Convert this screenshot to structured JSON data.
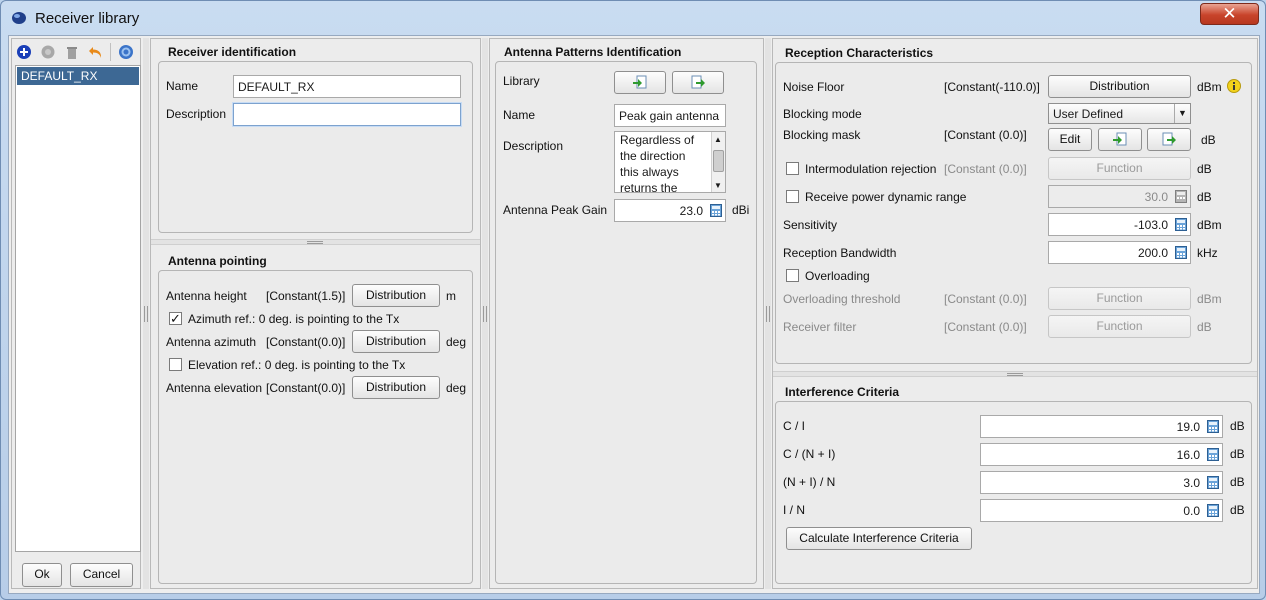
{
  "window": {
    "title": "Receiver library",
    "close_glyph": "✕"
  },
  "colors": {
    "accent": "#3d6894",
    "info": "#f2d21b",
    "close": "#c8442b"
  },
  "left": {
    "toolbar": [
      "add-icon",
      "disabled-circle-icon",
      "trash-icon",
      "undo-icon",
      "help-icon"
    ],
    "items": [
      {
        "label": "DEFAULT_RX"
      }
    ],
    "ok_label": "Ok",
    "cancel_label": "Cancel"
  },
  "receiver_id": {
    "title": "Receiver identification",
    "name_label": "Name",
    "name_value": "DEFAULT_RX",
    "description_label": "Description",
    "description_value": ""
  },
  "pointing": {
    "title": "Antenna pointing",
    "height_label": "Antenna height",
    "height_value": "[Constant(1.5)]",
    "height_unit": "m",
    "azimuth_ref": "Azimuth ref.: 0 deg. is pointing to the Tx",
    "azimuth_label": "Antenna azimuth",
    "azimuth_value": "[Constant(0.0)]",
    "azimuth_unit": "deg",
    "elevation_ref": "Elevation ref.: 0 deg. is pointing to the Tx",
    "elevation_label": "Antenna elevation",
    "elevation_value": "[Constant(0.0)]",
    "elevation_unit": "deg",
    "distribution_label": "Distribution"
  },
  "antenna": {
    "title": "Antenna Patterns Identification",
    "library_label": "Library",
    "name_label": "Name",
    "name_value": "Peak gain antenna",
    "description_label": "Description",
    "description_lines": [
      "Regardless of",
      "the direction",
      "this always",
      "returns the"
    ],
    "peak_gain_label": "Antenna Peak Gain",
    "peak_gain_value": "23.0",
    "peak_gain_unit": "dBi"
  },
  "reception": {
    "title": "Reception Characteristics",
    "noise_floor_label": "Noise Floor",
    "noise_floor_value": "[Constant(-110.0)]",
    "noise_floor_button": "Distribution",
    "noise_floor_unit": "dBm",
    "blocking_mode_label": "Blocking mode",
    "blocking_mode_value": "User Defined",
    "blocking_mask_label": "Blocking mask",
    "blocking_mask_value": "[Constant (0.0)]",
    "edit_label": "Edit",
    "blocking_mask_unit": "dB",
    "intermod_label": "Intermodulation rejection",
    "intermod_value": "[Constant (0.0)]",
    "intermod_unit": "dB",
    "function_label": "Function",
    "dynamic_label": "Receive power dynamic range",
    "dynamic_value": "30.0",
    "dynamic_unit": "dB",
    "sensitivity_label": "Sensitivity",
    "sensitivity_value": "-103.0",
    "sensitivity_unit": "dBm",
    "bandwidth_label": "Reception Bandwidth",
    "bandwidth_value": "200.0",
    "bandwidth_unit": "kHz",
    "overloading_label": "Overloading",
    "overloading_threshold_label": "Overloading threshold",
    "overloading_threshold_value": "[Constant (0.0)]",
    "overloading_threshold_unit": "dBm",
    "receiver_filter_label": "Receiver filter",
    "receiver_filter_value": "[Constant (0.0)]",
    "receiver_filter_unit": "dB"
  },
  "interference": {
    "title": "Interference Criteria",
    "rows": [
      {
        "label": "C / I",
        "value": "19.0",
        "unit": "dB"
      },
      {
        "label": "C / (N + I)",
        "value": "16.0",
        "unit": "dB"
      },
      {
        "label": "(N + I) / N",
        "value": "3.0",
        "unit": "dB"
      },
      {
        "label": "I / N",
        "value": "0.0",
        "unit": "dB"
      }
    ],
    "calculate_label": "Calculate Interference Criteria"
  }
}
